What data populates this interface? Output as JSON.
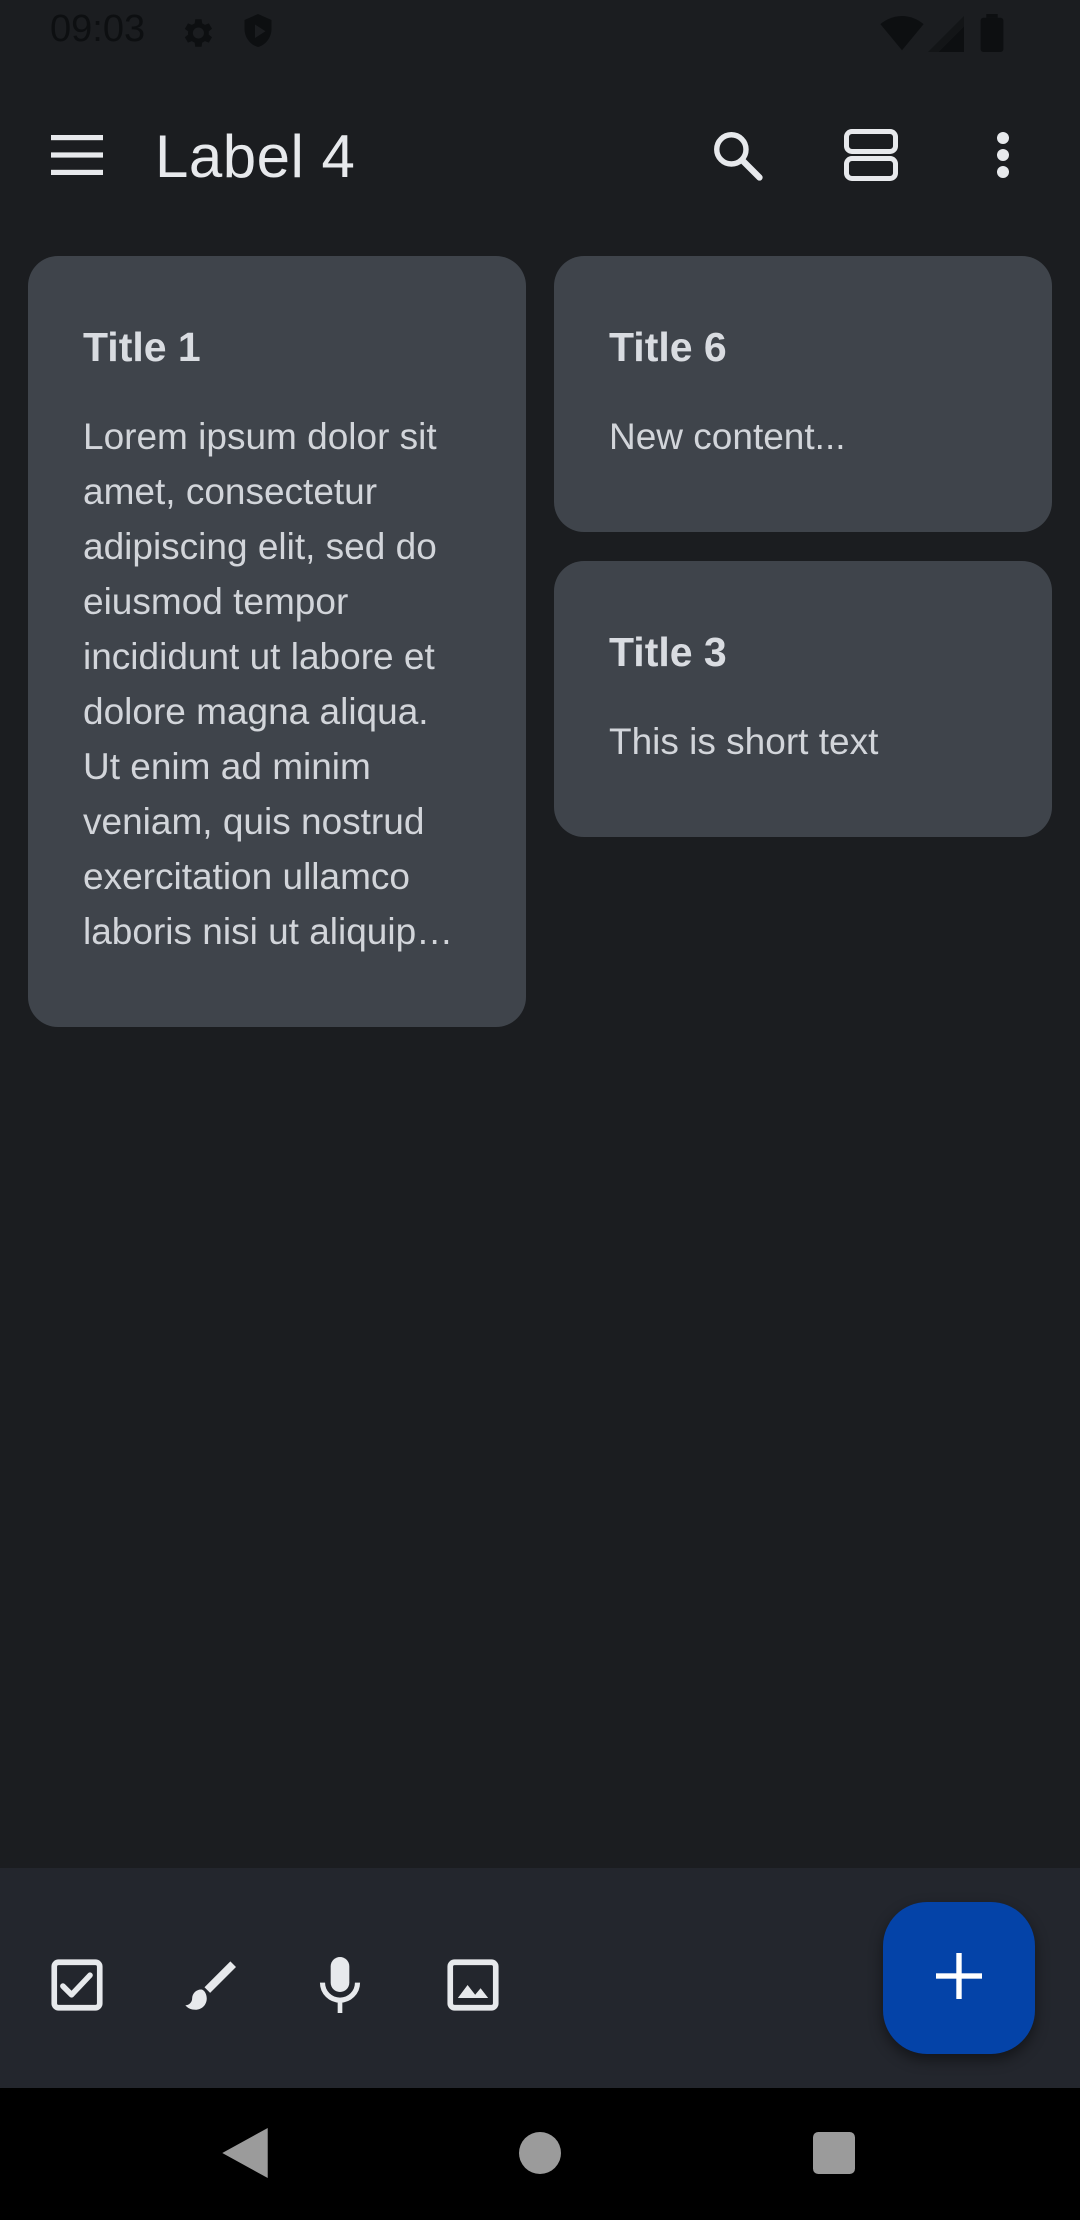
{
  "status_bar": {
    "time": "09:03",
    "icons": [
      "settings-icon",
      "shield-play-icon",
      "wifi-icon",
      "signal-icon",
      "battery-icon"
    ]
  },
  "app_bar": {
    "title": "Label 4",
    "actions": [
      "menu-icon",
      "search-icon",
      "view-toggle-icon",
      "more-vert-icon"
    ]
  },
  "notes": [
    {
      "title": "Title 1",
      "body_lines": [
        "Lorem ipsum dolor sit",
        "amet, consectetur",
        "adipiscing elit, sed do",
        "eiusmod tempor",
        "incididunt ut labore et",
        "dolore magna aliqua.",
        "Ut enim ad minim",
        "veniam, quis nostrud",
        "exercitation ullamco",
        "laboris nisi ut aliquip…"
      ]
    },
    {
      "title": "Title 6",
      "body": "New content..."
    },
    {
      "title": "Title 3",
      "body": "This is short text"
    }
  ],
  "bottom_bar": {
    "tools": [
      "checkbox-icon",
      "brush-icon",
      "mic-icon",
      "image-icon"
    ],
    "fab": "add-icon"
  },
  "nav_bar": [
    "back-icon",
    "home-icon",
    "recents-icon"
  ],
  "colors": {
    "background": "#1b1d20",
    "card": "#3f444b",
    "bottom_bar": "#23262d",
    "fab": "#0443a8"
  }
}
